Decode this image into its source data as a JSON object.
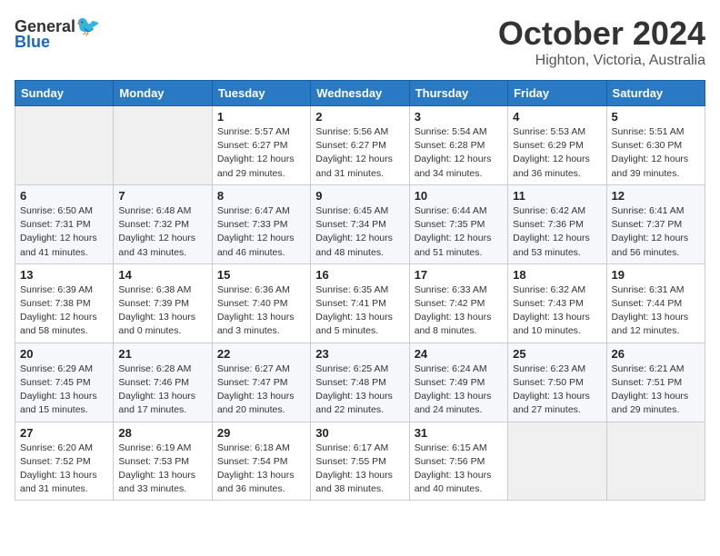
{
  "header": {
    "logo_general": "General",
    "logo_blue": "Blue",
    "month": "October 2024",
    "location": "Highton, Victoria, Australia"
  },
  "weekdays": [
    "Sunday",
    "Monday",
    "Tuesday",
    "Wednesday",
    "Thursday",
    "Friday",
    "Saturday"
  ],
  "weeks": [
    [
      {
        "day": "",
        "sunrise": "",
        "sunset": "",
        "daylight": ""
      },
      {
        "day": "",
        "sunrise": "",
        "sunset": "",
        "daylight": ""
      },
      {
        "day": "1",
        "sunrise": "Sunrise: 5:57 AM",
        "sunset": "Sunset: 6:27 PM",
        "daylight": "Daylight: 12 hours and 29 minutes."
      },
      {
        "day": "2",
        "sunrise": "Sunrise: 5:56 AM",
        "sunset": "Sunset: 6:27 PM",
        "daylight": "Daylight: 12 hours and 31 minutes."
      },
      {
        "day": "3",
        "sunrise": "Sunrise: 5:54 AM",
        "sunset": "Sunset: 6:28 PM",
        "daylight": "Daylight: 12 hours and 34 minutes."
      },
      {
        "day": "4",
        "sunrise": "Sunrise: 5:53 AM",
        "sunset": "Sunset: 6:29 PM",
        "daylight": "Daylight: 12 hours and 36 minutes."
      },
      {
        "day": "5",
        "sunrise": "Sunrise: 5:51 AM",
        "sunset": "Sunset: 6:30 PM",
        "daylight": "Daylight: 12 hours and 39 minutes."
      }
    ],
    [
      {
        "day": "6",
        "sunrise": "Sunrise: 6:50 AM",
        "sunset": "Sunset: 7:31 PM",
        "daylight": "Daylight: 12 hours and 41 minutes."
      },
      {
        "day": "7",
        "sunrise": "Sunrise: 6:48 AM",
        "sunset": "Sunset: 7:32 PM",
        "daylight": "Daylight: 12 hours and 43 minutes."
      },
      {
        "day": "8",
        "sunrise": "Sunrise: 6:47 AM",
        "sunset": "Sunset: 7:33 PM",
        "daylight": "Daylight: 12 hours and 46 minutes."
      },
      {
        "day": "9",
        "sunrise": "Sunrise: 6:45 AM",
        "sunset": "Sunset: 7:34 PM",
        "daylight": "Daylight: 12 hours and 48 minutes."
      },
      {
        "day": "10",
        "sunrise": "Sunrise: 6:44 AM",
        "sunset": "Sunset: 7:35 PM",
        "daylight": "Daylight: 12 hours and 51 minutes."
      },
      {
        "day": "11",
        "sunrise": "Sunrise: 6:42 AM",
        "sunset": "Sunset: 7:36 PM",
        "daylight": "Daylight: 12 hours and 53 minutes."
      },
      {
        "day": "12",
        "sunrise": "Sunrise: 6:41 AM",
        "sunset": "Sunset: 7:37 PM",
        "daylight": "Daylight: 12 hours and 56 minutes."
      }
    ],
    [
      {
        "day": "13",
        "sunrise": "Sunrise: 6:39 AM",
        "sunset": "Sunset: 7:38 PM",
        "daylight": "Daylight: 12 hours and 58 minutes."
      },
      {
        "day": "14",
        "sunrise": "Sunrise: 6:38 AM",
        "sunset": "Sunset: 7:39 PM",
        "daylight": "Daylight: 13 hours and 0 minutes."
      },
      {
        "day": "15",
        "sunrise": "Sunrise: 6:36 AM",
        "sunset": "Sunset: 7:40 PM",
        "daylight": "Daylight: 13 hours and 3 minutes."
      },
      {
        "day": "16",
        "sunrise": "Sunrise: 6:35 AM",
        "sunset": "Sunset: 7:41 PM",
        "daylight": "Daylight: 13 hours and 5 minutes."
      },
      {
        "day": "17",
        "sunrise": "Sunrise: 6:33 AM",
        "sunset": "Sunset: 7:42 PM",
        "daylight": "Daylight: 13 hours and 8 minutes."
      },
      {
        "day": "18",
        "sunrise": "Sunrise: 6:32 AM",
        "sunset": "Sunset: 7:43 PM",
        "daylight": "Daylight: 13 hours and 10 minutes."
      },
      {
        "day": "19",
        "sunrise": "Sunrise: 6:31 AM",
        "sunset": "Sunset: 7:44 PM",
        "daylight": "Daylight: 13 hours and 12 minutes."
      }
    ],
    [
      {
        "day": "20",
        "sunrise": "Sunrise: 6:29 AM",
        "sunset": "Sunset: 7:45 PM",
        "daylight": "Daylight: 13 hours and 15 minutes."
      },
      {
        "day": "21",
        "sunrise": "Sunrise: 6:28 AM",
        "sunset": "Sunset: 7:46 PM",
        "daylight": "Daylight: 13 hours and 17 minutes."
      },
      {
        "day": "22",
        "sunrise": "Sunrise: 6:27 AM",
        "sunset": "Sunset: 7:47 PM",
        "daylight": "Daylight: 13 hours and 20 minutes."
      },
      {
        "day": "23",
        "sunrise": "Sunrise: 6:25 AM",
        "sunset": "Sunset: 7:48 PM",
        "daylight": "Daylight: 13 hours and 22 minutes."
      },
      {
        "day": "24",
        "sunrise": "Sunrise: 6:24 AM",
        "sunset": "Sunset: 7:49 PM",
        "daylight": "Daylight: 13 hours and 24 minutes."
      },
      {
        "day": "25",
        "sunrise": "Sunrise: 6:23 AM",
        "sunset": "Sunset: 7:50 PM",
        "daylight": "Daylight: 13 hours and 27 minutes."
      },
      {
        "day": "26",
        "sunrise": "Sunrise: 6:21 AM",
        "sunset": "Sunset: 7:51 PM",
        "daylight": "Daylight: 13 hours and 29 minutes."
      }
    ],
    [
      {
        "day": "27",
        "sunrise": "Sunrise: 6:20 AM",
        "sunset": "Sunset: 7:52 PM",
        "daylight": "Daylight: 13 hours and 31 minutes."
      },
      {
        "day": "28",
        "sunrise": "Sunrise: 6:19 AM",
        "sunset": "Sunset: 7:53 PM",
        "daylight": "Daylight: 13 hours and 33 minutes."
      },
      {
        "day": "29",
        "sunrise": "Sunrise: 6:18 AM",
        "sunset": "Sunset: 7:54 PM",
        "daylight": "Daylight: 13 hours and 36 minutes."
      },
      {
        "day": "30",
        "sunrise": "Sunrise: 6:17 AM",
        "sunset": "Sunset: 7:55 PM",
        "daylight": "Daylight: 13 hours and 38 minutes."
      },
      {
        "day": "31",
        "sunrise": "Sunrise: 6:15 AM",
        "sunset": "Sunset: 7:56 PM",
        "daylight": "Daylight: 13 hours and 40 minutes."
      },
      {
        "day": "",
        "sunrise": "",
        "sunset": "",
        "daylight": ""
      },
      {
        "day": "",
        "sunrise": "",
        "sunset": "",
        "daylight": ""
      }
    ]
  ]
}
